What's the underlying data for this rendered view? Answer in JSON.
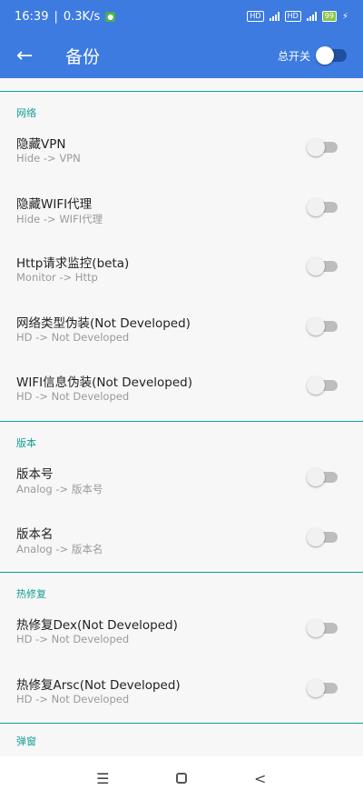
{
  "status": {
    "time": "16:39",
    "speed": "0.3K/s",
    "battery": "99"
  },
  "toolbar": {
    "back_icon": "←",
    "title": "备份",
    "master_label": "总开关"
  },
  "sections": {
    "network": {
      "title": "网络",
      "items": [
        {
          "label": "隐藏VPN",
          "sub": "Hide -> VPN"
        },
        {
          "label": "隐藏WIFI代理",
          "sub": "Hide -> WIFI代理"
        },
        {
          "label": "Http请求监控(beta)",
          "sub": "Monitor -> Http"
        },
        {
          "label": "网络类型伪装(Not Developed)",
          "sub": "HD -> Not Developed"
        },
        {
          "label": "WIFI信息伪装(Not Developed)",
          "sub": "HD -> Not Developed"
        }
      ]
    },
    "version": {
      "title": "版本",
      "items": [
        {
          "label": "版本号",
          "sub": "Analog -> 版本号"
        },
        {
          "label": "版本名",
          "sub": "Analog -> 版本名"
        }
      ]
    },
    "hotfix": {
      "title": "热修复",
      "items": [
        {
          "label": "热修复Dex(Not Developed)",
          "sub": "HD -> Not Developed"
        },
        {
          "label": "热修复Arsc(Not Developed)",
          "sub": "HD -> Not Developed"
        }
      ]
    },
    "popup": {
      "title": "弹窗"
    }
  },
  "nav": {
    "menu_icon": "☰",
    "back_icon": "<"
  },
  "colors": {
    "primary": "#3d7be0",
    "accent": "#129e95"
  }
}
